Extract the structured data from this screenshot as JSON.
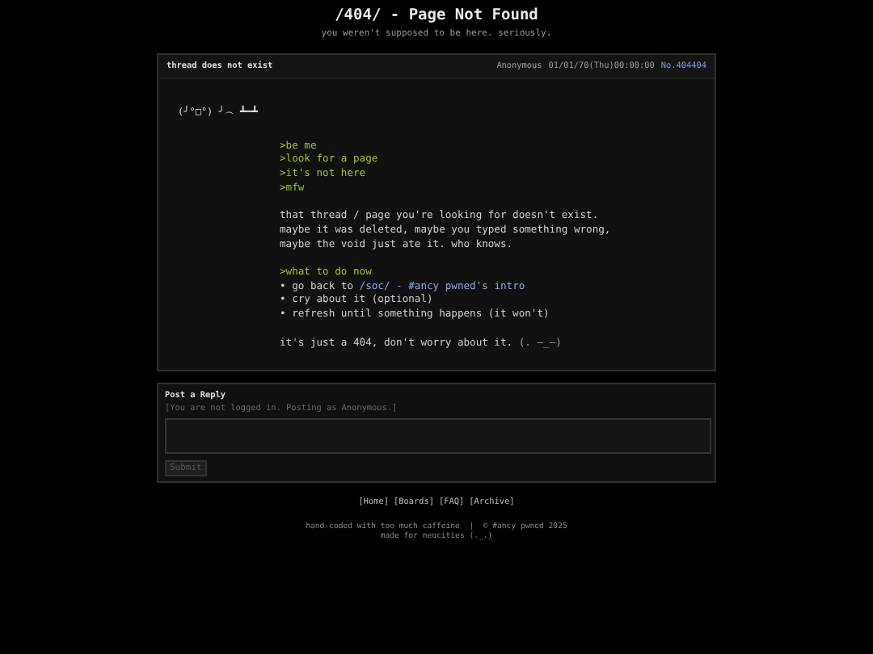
{
  "header": {
    "title": "/404/ - Page Not Found",
    "subtitle": "you weren't supposed to be here. seriously."
  },
  "post": {
    "subject": "thread does not exist",
    "name": "Anonymous",
    "date": "01/01/70(Thu)00:00:00",
    "number": "No.404404",
    "kaomoji": "(╯°□°) ╯︵ ┻━┻",
    "blocks": [
      {
        "lines": [
          {
            "kind": "greentext",
            "text": ">be me"
          },
          {
            "kind": "greentext",
            "text": ">look for a page"
          },
          {
            "kind": "greentext",
            "text": ">it's not here"
          },
          {
            "kind": "greentext",
            "text": ">mfw"
          }
        ]
      },
      {
        "lines": [
          {
            "kind": "text",
            "text": "that thread / page you're looking for doesn't exist."
          },
          {
            "kind": "text",
            "text": "maybe it was deleted, maybe you typed something wrong,"
          },
          {
            "kind": "text",
            "text": "maybe the void just ate it. who knows."
          }
        ]
      },
      {
        "lines": [
          {
            "kind": "greentext",
            "text": ">what to do now"
          },
          {
            "kind": "text",
            "text": "• go back to",
            "link": "/soc/ - #ancy pwned's intro"
          },
          {
            "kind": "text",
            "text": "• cry about it (optional)"
          },
          {
            "kind": "text",
            "text": "• refresh until something happens (it won't)"
          }
        ]
      },
      {
        "lines": [
          {
            "kind": "text",
            "text": "it's just a 404, don't worry about it.",
            "emote": "(. —_—)"
          }
        ]
      }
    ]
  },
  "reply": {
    "title": "Post a Reply",
    "note": "[You are not logged in. Posting as Anonymous.]",
    "submit": "Submit"
  },
  "nav": [
    "[Home]",
    "[Boards]",
    "[FAQ]",
    "[Archive]"
  ],
  "footer": [
    "hand-coded with too much caffeine  |  © #ancy pwned 2025",
    "made for neocities (._.)"
  ]
}
